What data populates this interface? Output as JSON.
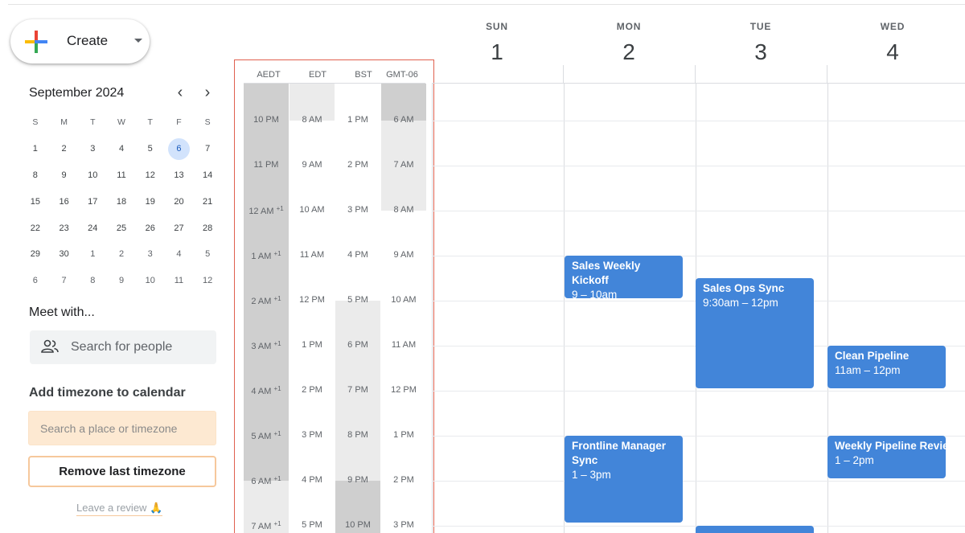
{
  "create": {
    "label": "Create"
  },
  "mini_calendar": {
    "title": "September 2024",
    "prev": "‹",
    "next": "›",
    "weekdays": [
      "S",
      "M",
      "T",
      "W",
      "T",
      "F",
      "S"
    ],
    "weeks": [
      [
        "1",
        "2",
        "3",
        "4",
        "5",
        "6",
        "7"
      ],
      [
        "8",
        "9",
        "10",
        "11",
        "12",
        "13",
        "14"
      ],
      [
        "15",
        "16",
        "17",
        "18",
        "19",
        "20",
        "21"
      ],
      [
        "22",
        "23",
        "24",
        "25",
        "26",
        "27",
        "28"
      ],
      [
        "29",
        "30",
        "1",
        "2",
        "3",
        "4",
        "5"
      ],
      [
        "6",
        "7",
        "8",
        "9",
        "10",
        "11",
        "12"
      ]
    ],
    "today": "6"
  },
  "meet": {
    "title": "Meet with...",
    "search_placeholder": "Search for people"
  },
  "timezone": {
    "title": "Add timezone to calendar",
    "placeholder": "Search a place or timezone",
    "remove_label": "Remove last timezone",
    "review_link": "Leave a review 🙏"
  },
  "tz_columns": [
    {
      "name": "AEDT",
      "hours": [
        "10 PM",
        "11 PM",
        "12 AM",
        "1 AM",
        "2 AM",
        "3 AM",
        "4 AM",
        "5 AM",
        "6 AM",
        "7 AM"
      ],
      "next_day_from": 2
    },
    {
      "name": "EDT",
      "hours": [
        "8 AM",
        "9 AM",
        "10 AM",
        "11 AM",
        "12 PM",
        "1 PM",
        "2 PM",
        "3 PM",
        "4 PM",
        "5 PM"
      ]
    },
    {
      "name": "BST",
      "hours": [
        "1 PM",
        "2 PM",
        "3 PM",
        "4 PM",
        "5 PM",
        "6 PM",
        "7 PM",
        "8 PM",
        "9 PM",
        "10 PM"
      ]
    },
    {
      "name": "GMT-06",
      "hours": [
        "6 AM",
        "7 AM",
        "8 AM",
        "9 AM",
        "10 AM",
        "11 AM",
        "12 PM",
        "1 PM",
        "2 PM",
        "3 PM"
      ]
    }
  ],
  "next_day_marker": "+1",
  "days": [
    {
      "name": "SUN",
      "num": "1"
    },
    {
      "name": "MON",
      "num": "2"
    },
    {
      "name": "TUE",
      "num": "3"
    },
    {
      "name": "WED",
      "num": "4"
    }
  ],
  "events": [
    {
      "title": "Sales Weekly Kickoff",
      "time": "9 – 10am",
      "day": "MON"
    },
    {
      "title": "Sales Ops Sync",
      "time": "9:30am – 12pm",
      "day": "TUE"
    },
    {
      "title": "Clean Pipeline",
      "time": "11am – 12pm",
      "day": "WED"
    },
    {
      "title": "Frontline Manager Sync",
      "time": "1 – 3pm",
      "day": "MON"
    },
    {
      "title": "Weekly Pipeline Review",
      "time": "1 – 2pm",
      "day": "WED"
    }
  ],
  "colors": {
    "event": "#4285d9",
    "today_bg": "#d2e3fc",
    "frame": "#e0604f",
    "band_dark": "#cfcfcf",
    "band_light": "#ebebeb"
  }
}
